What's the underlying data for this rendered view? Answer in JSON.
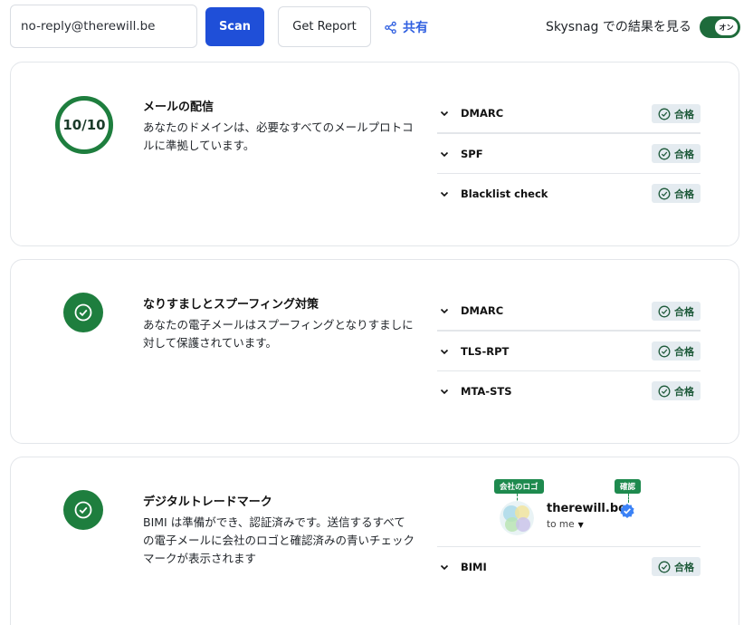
{
  "topbar": {
    "email_value": "no-reply@therewill.be",
    "scan_label": "Scan",
    "report_label": "Get Report",
    "share_label": "共有",
    "toggle_label": "Skysnag での結果を見る",
    "toggle_state": "オン"
  },
  "colors": {
    "primary": "#1f4fd8",
    "success": "#1e7e3e",
    "badge_bg": "#e4ebf0",
    "share": "#2f5fe0"
  },
  "cards": [
    {
      "score": "10/10",
      "title": "メールの配信",
      "description": "あなたのドメインは、必要なすべてのメールプロトコルに準拠しています。",
      "checks": [
        {
          "name": "DMARC",
          "status": "合格"
        },
        {
          "name": "SPF",
          "status": "合格"
        },
        {
          "name": "Blacklist check",
          "status": "合格"
        }
      ]
    },
    {
      "icon": "check-circle-icon",
      "title": "なりすましとスプーフィング対策",
      "description": "あなたの電子メールはスプーフィングとなりすましに対して保護されています。",
      "checks": [
        {
          "name": "DMARC",
          "status": "合格"
        },
        {
          "name": "TLS-RPT",
          "status": "合格"
        },
        {
          "name": "MTA-STS",
          "status": "合格"
        }
      ]
    },
    {
      "icon": "check-circle-icon",
      "title": "デジタルトレードマーク",
      "description": "BIMI は準備ができ、認証済みです。送信するすべての電子メールに会社のロゴと確認済みの青いチェックマークが表示されます",
      "bimi_preview": {
        "logo_tag": "会社のロゴ",
        "verified_tag": "確認",
        "sender": "therewill.be",
        "recipient": "to me"
      },
      "checks": [
        {
          "name": "BIMI",
          "status": "合格"
        }
      ]
    }
  ]
}
